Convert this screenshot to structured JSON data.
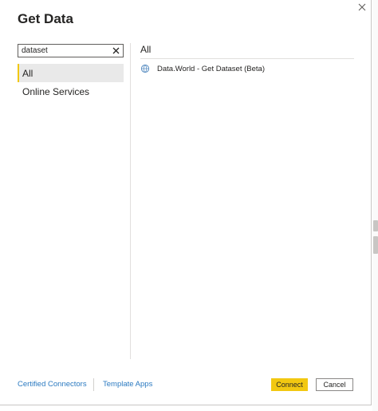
{
  "dialog": {
    "title": "Get Data",
    "close_icon": "close-icon"
  },
  "search": {
    "value": "dataset",
    "clear_icon": "clear-icon"
  },
  "categories": [
    {
      "label": "All",
      "selected": true
    },
    {
      "label": "Online Services",
      "selected": false
    }
  ],
  "results": {
    "section_title": "All",
    "items": [
      {
        "label": "Data.World - Get Dataset (Beta)",
        "icon": "data-world-icon"
      }
    ]
  },
  "footer": {
    "certified_connectors": "Certified Connectors",
    "template_apps": "Template Apps",
    "connect_label": "Connect",
    "cancel_label": "Cancel"
  },
  "colors": {
    "accent": "#f2c811",
    "link": "#2b7ac1",
    "selected_bg": "#e9e9e9"
  }
}
